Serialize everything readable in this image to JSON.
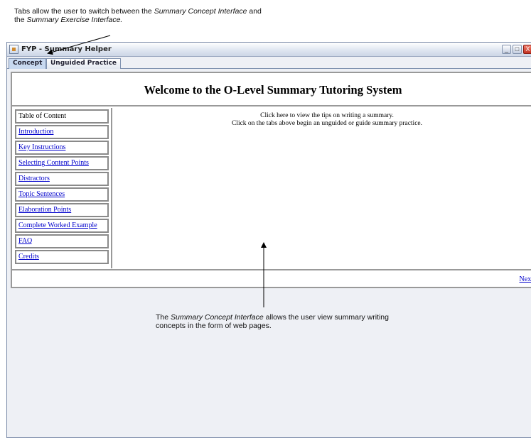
{
  "annotations": {
    "top": {
      "part1": "Tabs allow the user to switch between the",
      "em1": "Summary Concept Interface",
      "part2": "and the",
      "em2": "Summary Exercise Interface."
    },
    "bottom": {
      "part1": "The",
      "em1": "Summary Concept Interface",
      "part2": "allows the user view summary writing concepts in the form of web pages."
    }
  },
  "window": {
    "title": "FYP - Summary Helper",
    "controls": {
      "minimize": "_",
      "maximize": "□",
      "close": "X"
    }
  },
  "tabs": [
    {
      "label": "Concept",
      "selected": true
    },
    {
      "label": "Unguided Practice",
      "selected": false
    }
  ],
  "page": {
    "heading": "Welcome to the O-Level Summary Tutoring System",
    "toc_header": "Table of Content",
    "toc_items": [
      "Introduction",
      "Key Instructions",
      "Selecting Content Points",
      "Distractors",
      "Topic Sentences",
      "Elaboration Points",
      "Complete Worked Example",
      "FAQ",
      "Credits"
    ],
    "message_line1": "Click here to view the tips on writing a summary.",
    "message_line2": "Click on the tabs above begin an unguided or guide summary practice.",
    "next_label": "Next"
  },
  "colors": {
    "link": "#0000cc",
    "selected_tab": "#c8d9f0",
    "close_button": "#c23020"
  }
}
